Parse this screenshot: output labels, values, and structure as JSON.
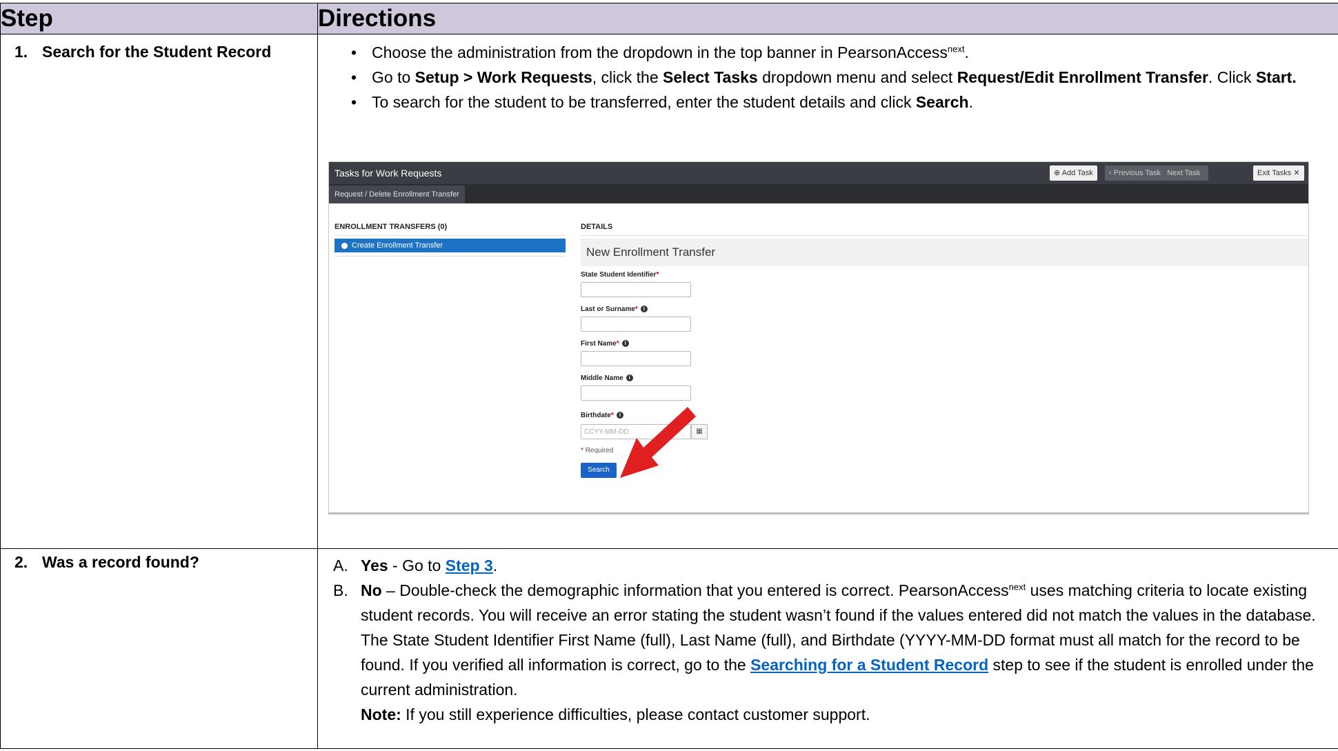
{
  "table": {
    "header_step": "Step",
    "header_directions": "Directions"
  },
  "row1": {
    "num": "1.",
    "label": "Search for the Student Record",
    "bullets": {
      "b1_text": "Choose the administration from the dropdown in the top banner in PearsonAccess",
      "b1_sup": "next",
      "b1_end": ".",
      "b2_pre": "Go to ",
      "b2_bold1": "Setup > Work Requests",
      "b2_mid1": ", click the ",
      "b2_bold2": "Select Tasks",
      "b2_mid2": " dropdown menu and select ",
      "b2_bold3": "Request/Edit Enrollment Transfer",
      "b2_mid3": ". Click ",
      "b2_bold4": "Start.",
      "b3_pre": "To search for the student to be transferred, enter the student details and click ",
      "b3_bold": "Search",
      "b3_end": "."
    }
  },
  "screenshot": {
    "title": "Tasks for Work Requests",
    "add_task": "Add Task",
    "prev_task": "Previous Task",
    "next_task": "Next Task",
    "exit_tasks": "Exit Tasks",
    "tab": "Request / Delete Enrollment Transfer",
    "left_header": "ENROLLMENT TRANSFERS (0)",
    "create_btn": "Create Enrollment Transfer",
    "details_header": "DETAILS",
    "details_title": "New Enrollment Transfer",
    "field1": "State Student Identifier",
    "field2": "Last or Surname",
    "field3": "First Name",
    "field4": "Middle Name",
    "field5": "Birthdate",
    "birthdate_placeholder": "CCYY-MM-DD",
    "required_note": "Required",
    "search_btn": "Search",
    "colors": {
      "banner": "#3a3d43",
      "accent": "#1a64c9",
      "arrow": "#e02020"
    }
  },
  "row2": {
    "num": "2.",
    "label": "Was a record found?",
    "a_mark": "A.",
    "a_bold": "Yes",
    "a_text": " - Go to ",
    "a_link": "Step 3",
    "a_end": ".",
    "b_mark": "B.",
    "b_bold": "No",
    "b_text1": " – Double-check the demographic information that you entered is correct. PearsonAccess",
    "b_sup": "next",
    "b_text2": " uses matching criteria to locate existing student records. You will receive an error stating the student wasn’t found if the values entered did not match the values in the database. The State Student Identifier First Name (full), Last Name (full), and Birthdate (YYYY-MM-DD format must all match for the record to be found. If you verified all information is correct, go to the ",
    "b_link": "Searching for a Student Record",
    "b_text3": " step to see if the student is enrolled under the current administration.",
    "note_bold": "Note:",
    "note_text": " If you still experience difficulties, please contact customer support."
  }
}
